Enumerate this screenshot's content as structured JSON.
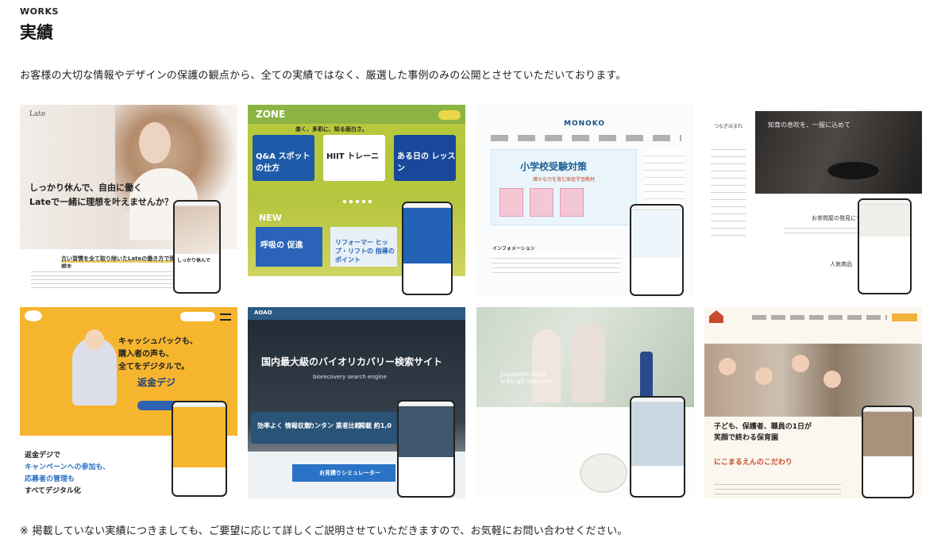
{
  "section": {
    "eyebrow": "WORKS",
    "title": "実績",
    "intro": "お客様の大切な情報やデザインの保護の観点から、全ての実績ではなく、厳選した事例のみの公開とさせていただいております。",
    "footnote": "※ 掲載していない実績につきましても、ご要望に応じて詳しくご説明させていただきますので、お気軽にお問い合わせください。"
  },
  "works": [
    {
      "logo": "Late",
      "copy_line1": "しっかり休んで、自由に働く",
      "copy_line2": "Lateで一緒に理想を叶えませんか？",
      "band": "古い習慣を全て取り除いたLateの働き方で理想を",
      "phone_text": "しっかり休んで"
    },
    {
      "logo": "ZONE",
      "tagline": "楽く、多彩に、知る面白さ。",
      "tile1": "Q&A スポットの仕方",
      "tile2": "HIIT トレーニ",
      "tile3": "ある日の レッスン",
      "new_label": "NEW",
      "tile4": "呼吸の 促進",
      "tile5": "リフォーマー ヒップ・リフトの 指導のポイント"
    },
    {
      "brand": "MONOKO",
      "hero_title": "小学校受験対策",
      "hero_sub": "確かな力を育む家庭学習教材",
      "info": "インフォメーション"
    },
    {
      "hero_caption": "知育の息吹を、一服に込めて",
      "logo": "つなぎほまれ",
      "heading": "お茶問屋の発見につ",
      "popular": "人気商品"
    },
    {
      "copy_line1": "キャッシュバックも、",
      "copy_line2": "購入者の声も、",
      "copy_line3": "全てをデジタルで。",
      "brand": "返金デジ",
      "bottom_line1": "返金デジで",
      "bottom_line2": "キャンペーンへの参加も、",
      "bottom_line3": "応募者の管理も",
      "bottom_line4": "すべてデジタル化"
    },
    {
      "logo": "AOAO",
      "headline": "国内最大級のバイオリカバリー検索サイト",
      "sub": "biorecovery  search engine",
      "strip1": "効率よく 情報収集",
      "strip2": "カンタン 業者比較",
      "strip3": "掲載 約1,0",
      "button": "お見積りシミュレーター"
    },
    {
      "caption_line1": "Japanese sake",
      "caption_line2": "with all seasons"
    },
    {
      "copy_line1": "子ども、保護者、職員の1日が",
      "copy_line2": "笑顔で終わる保育園",
      "sub": "にこまるえんのこだわり"
    }
  ]
}
